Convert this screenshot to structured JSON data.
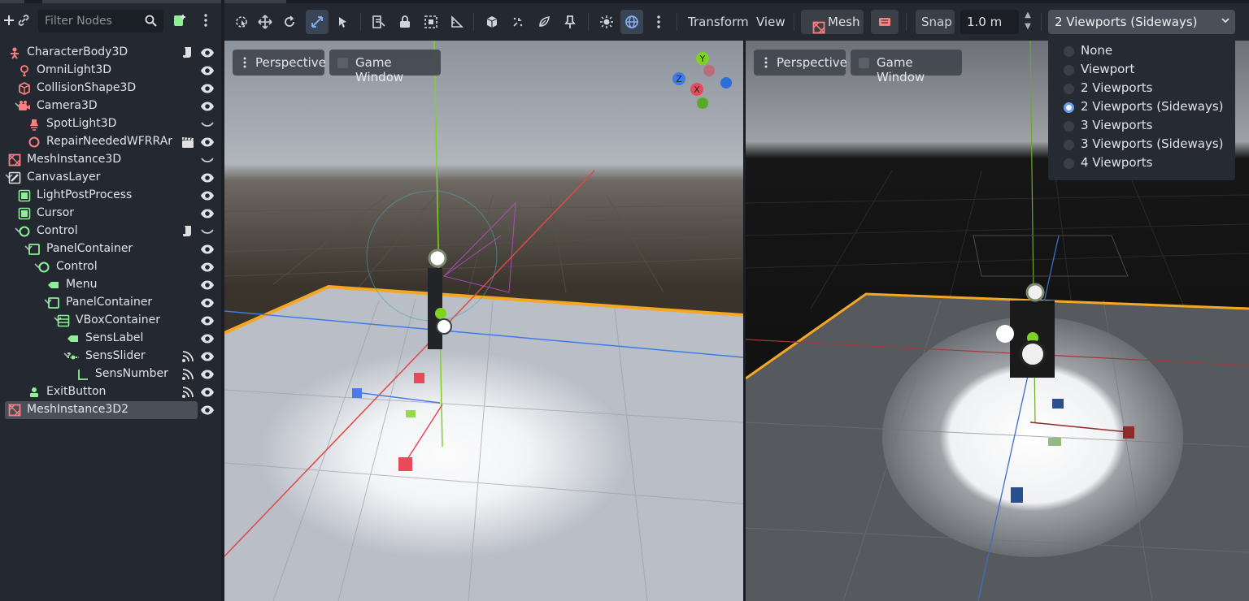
{
  "scene_tree": {
    "filter_placeholder": "Filter Nodes",
    "nodes": [
      {
        "label": "CharacterBody3D",
        "depth": 0,
        "icon": "character-body-icon",
        "color": "#fc7f7f",
        "arrow": "",
        "extra": "script-icon",
        "visibility": "visible"
      },
      {
        "label": "OmniLight3D",
        "depth": 1,
        "icon": "omni-light-icon",
        "color": "#fc7f7f",
        "arrow": "",
        "extra": "",
        "visibility": "visible"
      },
      {
        "label": "CollisionShape3D",
        "depth": 1,
        "icon": "collision-shape-icon",
        "color": "#fc7f7f",
        "arrow": "",
        "extra": "",
        "visibility": "visible"
      },
      {
        "label": "Camera3D",
        "depth": 1,
        "icon": "camera-icon",
        "color": "#fc7f7f",
        "arrow": "expanded",
        "extra": "",
        "visibility": "visible"
      },
      {
        "label": "SpotLight3D",
        "depth": 2,
        "icon": "spot-light-icon",
        "color": "#fc7f7f",
        "arrow": "",
        "extra": "",
        "visibility": "hidden"
      },
      {
        "label": "RepairNeededWFRRAr",
        "depth": 2,
        "icon": "node3d-icon",
        "color": "#fc7f7f",
        "arrow": "",
        "extra": "clapperboard-icon",
        "visibility": "visible"
      },
      {
        "label": "MeshInstance3D",
        "depth": 0,
        "icon": "mesh-instance-icon",
        "color": "#fc7f7f",
        "arrow": "",
        "extra": "",
        "visibility": "hidden"
      },
      {
        "label": "CanvasLayer",
        "depth": 0,
        "icon": "canvas-layer-icon",
        "color": "#e0e0e0",
        "arrow": "expanded",
        "extra": "",
        "visibility": "visible"
      },
      {
        "label": "LightPostProcess",
        "depth": 1,
        "icon": "color-rect-icon",
        "color": "#8eef97",
        "arrow": "",
        "extra": "",
        "visibility": "visible"
      },
      {
        "label": "Cursor",
        "depth": 1,
        "icon": "color-rect-icon",
        "color": "#8eef97",
        "arrow": "",
        "extra": "",
        "visibility": "visible"
      },
      {
        "label": "Control",
        "depth": 1,
        "icon": "control-icon",
        "color": "#8eef97",
        "arrow": "expanded",
        "extra": "script-icon",
        "visibility": "hidden"
      },
      {
        "label": "PanelContainer",
        "depth": 2,
        "icon": "panel-container-icon",
        "color": "#8eef97",
        "arrow": "expanded",
        "extra": "",
        "visibility": "visible"
      },
      {
        "label": "Control",
        "depth": 3,
        "icon": "control-icon",
        "color": "#8eef97",
        "arrow": "expanded",
        "extra": "",
        "visibility": "visible"
      },
      {
        "label": "Menu",
        "depth": 4,
        "icon": "label-icon",
        "color": "#8eef97",
        "arrow": "",
        "extra": "",
        "visibility": "visible"
      },
      {
        "label": "PanelContainer",
        "depth": 4,
        "icon": "panel-container-icon",
        "color": "#8eef97",
        "arrow": "expanded",
        "extra": "",
        "visibility": "visible"
      },
      {
        "label": "VBoxContainer",
        "depth": 5,
        "icon": "vbox-container-icon",
        "color": "#8eef97",
        "arrow": "expanded",
        "extra": "",
        "visibility": "visible"
      },
      {
        "label": "SensLabel",
        "depth": 6,
        "icon": "label-icon",
        "color": "#8eef97",
        "arrow": "",
        "extra": "",
        "visibility": "visible"
      },
      {
        "label": "SensSlider",
        "depth": 6,
        "icon": "hslider-icon",
        "color": "#8eef97",
        "arrow": "expanded",
        "extra": "signal-icon",
        "visibility": "visible"
      },
      {
        "label": "SensNumber",
        "depth": 7,
        "icon": "number-label-icon",
        "color": "#8eef97",
        "arrow": "",
        "extra": "signal-icon",
        "visibility": "visible"
      },
      {
        "label": "ExitButton",
        "depth": 2,
        "icon": "button-icon",
        "color": "#8eef97",
        "arrow": "",
        "extra": "signal-icon",
        "visibility": "visible"
      },
      {
        "label": "MeshInstance3D2",
        "depth": 0,
        "icon": "mesh-instance-icon",
        "color": "#fc7f7f",
        "arrow": "",
        "extra": "",
        "visibility": "visible",
        "selected": true
      }
    ]
  },
  "toolbar": {
    "transform_menu": "Transform",
    "view_menu": "View",
    "mesh_menu": "Mesh",
    "snap_label": "Snap",
    "snap_value": "1.0 m",
    "layout_selected": "2 Viewports (Sideways)"
  },
  "viewports": [
    {
      "projection": "Perspective",
      "game_window": "Game Window"
    },
    {
      "projection": "Perspective",
      "game_window": "Game Window"
    }
  ],
  "gizmo_axes": {
    "y": "Y",
    "z": "Z",
    "x": "X"
  },
  "layout_dropdown": {
    "options": [
      {
        "label": "None",
        "checked": false
      },
      {
        "label": "Viewport",
        "checked": false
      },
      {
        "label": "2 Viewports",
        "checked": false
      },
      {
        "label": "2 Viewports (Sideways)",
        "checked": true
      },
      {
        "label": "3 Viewports",
        "checked": false
      },
      {
        "label": "3 Viewports (Sideways)",
        "checked": false
      },
      {
        "label": "4 Viewports",
        "checked": false
      }
    ]
  },
  "colors": {
    "accent": "#6a9ee8",
    "node3d": "#fc7f7f",
    "control": "#8eef97",
    "selection_outline": "#f5a623"
  }
}
